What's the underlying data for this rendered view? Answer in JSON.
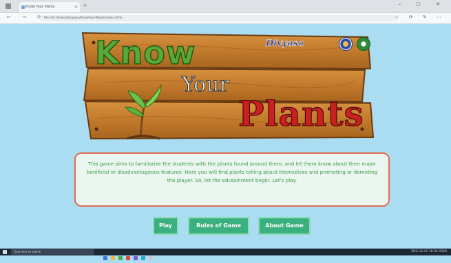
{
  "browser": {
    "tab_title": "Know Your Plants",
    "tab_close": "×",
    "new_tab": "+",
    "window_controls": "–  ▢  ✕",
    "nav_buttons": "←  →  ⟳",
    "url": "file:///C:/Users/Divyasa/KnowYourPlants/index.html",
    "toolbar_icons": "☆  ⟳  ✎  ⋯"
  },
  "banner": {
    "title_line1": "Know",
    "title_line2": "Your",
    "title_line3": "Plants",
    "brand": "Divyasa"
  },
  "description": "This game aims to familiarize the students with the plants found around them, and let them know about their major benificial or disadvantageous features. Here you will find plants telling about themselves and promoting or demoting the player. So, let the edutainment begin. Let's play.",
  "buttons": {
    "play": "Play",
    "rules": "Rules of Game",
    "about": "About Game"
  },
  "taskbar": {
    "search_placeholder": "Type here to search",
    "tray_text": "ENG  12:45  16-04-2020"
  },
  "colors": {
    "page_bg": "#aadcf2",
    "button_bg": "#3ab07e",
    "desc_border": "#e56b52",
    "desc_text": "#3e9a46"
  }
}
